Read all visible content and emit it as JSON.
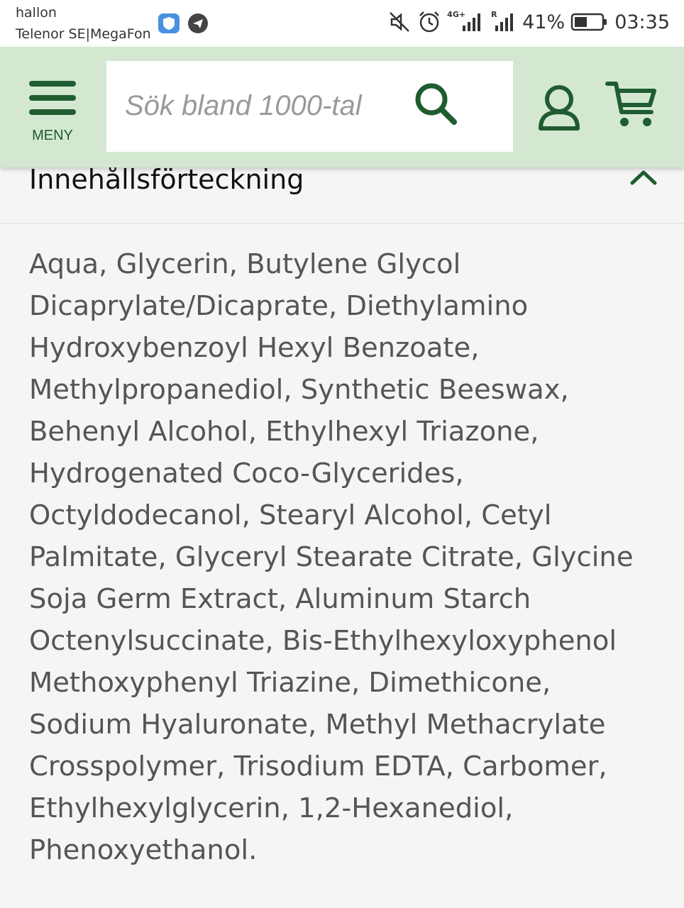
{
  "status_bar": {
    "carrier_line1": "hallon",
    "carrier_line2": "Telenor SE|MegaFon",
    "network_label": "4G+",
    "roaming_label": "R",
    "battery_percent": "41%",
    "time": "03:35",
    "icons": [
      "vpn-shield-icon",
      "telegram-icon",
      "mute-icon",
      "alarm-icon",
      "signal-icon",
      "battery-icon"
    ]
  },
  "header": {
    "menu_label": "MENY",
    "search_placeholder": "Sök bland 1000-tal",
    "accent_color": "#1f5c30",
    "background_color": "#d4e8d1"
  },
  "section": {
    "title": "Innehållsförteckning",
    "expanded": true
  },
  "ingredients": {
    "text": "Aqua, Glycerin, Butylene Glycol Dicaprylate/Dicaprate, Diethylamino Hydroxybenzoyl Hexyl Benzoate, Methylpropanediol, Synthetic Beeswax, Behenyl Alcohol, Ethylhexyl Triazone, Hydrogenated Coco-Glycerides, Octyldodecanol, Stearyl Alcohol, Cetyl Palmitate, Glyceryl Stearate Citrate, Glycine Soja Germ Extract, Aluminum Starch Octenylsuccinate, Bis-Ethylhexyloxyphenol Methoxyphenyl Triazine, Dimethicone, Sodium Hyaluronate, Methyl Methacrylate Crosspolymer, Trisodium EDTA, Carbomer, Ethylhexylglycerin, 1,2-Hexanediol, Phenoxyethanol."
  }
}
